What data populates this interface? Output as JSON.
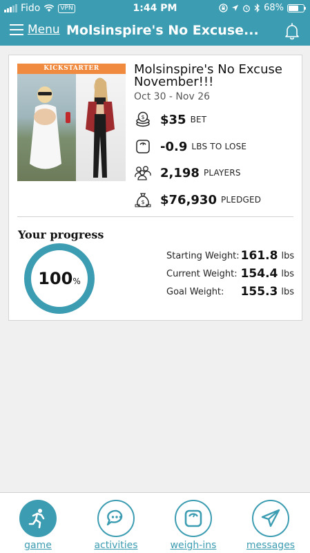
{
  "status_bar": {
    "carrier": "Fido",
    "vpn": "VPN",
    "time": "1:44 PM",
    "battery": "68%",
    "battery_level": 0.68
  },
  "nav": {
    "menu_label": "Menu",
    "title": "Molsinspire's No Excuse...",
    "bell_icon": "bell-icon"
  },
  "game": {
    "banner": "KICKSTARTER",
    "title": "Molsinspire's No Excuse November!!!",
    "dates": "Oct 30 - Nov 26",
    "stats": [
      {
        "icon": "coins-icon",
        "value": "$35",
        "unit": "BET"
      },
      {
        "icon": "scale-icon",
        "value": "-0.9",
        "unit": "LBS TO LOSE"
      },
      {
        "icon": "players-icon",
        "value": "2,198",
        "unit": "PLAYERS"
      },
      {
        "icon": "moneybag-icon",
        "value": "$76,930",
        "unit": "PLEDGED"
      }
    ]
  },
  "progress": {
    "label": "Your progress",
    "value": "100",
    "unit": "%",
    "weights": [
      {
        "label": "Starting Weight:",
        "value": "161.8",
        "unit": "lbs"
      },
      {
        "label": "Current Weight:",
        "value": "154.4",
        "unit": "lbs"
      },
      {
        "label": "Goal Weight:",
        "value": "155.3",
        "unit": "lbs"
      }
    ]
  },
  "tabs": [
    {
      "label": "game",
      "icon": "runner-icon",
      "active": true
    },
    {
      "label": "activities",
      "icon": "chat-bubbles-icon",
      "active": false
    },
    {
      "label": "weigh-ins",
      "icon": "scale-icon",
      "active": false
    },
    {
      "label": "messages",
      "icon": "paper-plane-icon",
      "active": false
    }
  ],
  "colors": {
    "accent": "#3c9cb1",
    "banner": "#ef8a3e"
  }
}
